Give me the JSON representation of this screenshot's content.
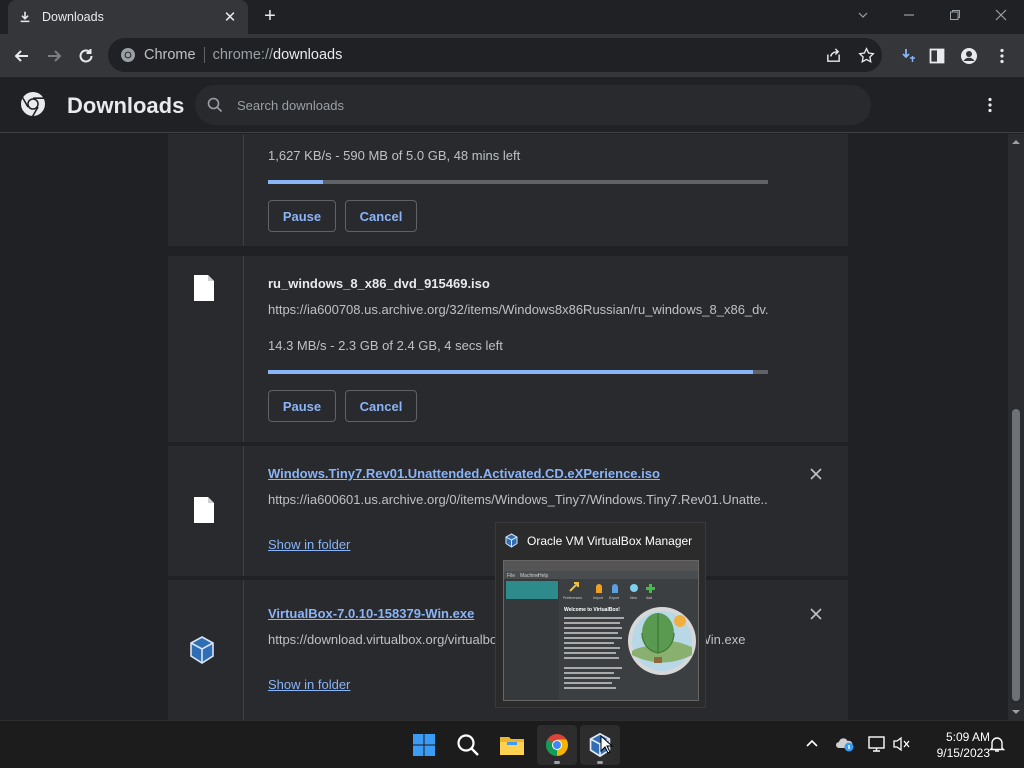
{
  "tab": {
    "title": "Downloads",
    "icon": "download-icon"
  },
  "window_controls": {
    "search_tabs": "chevron-down-icon",
    "minimize": "minimize-icon",
    "restore": "restore-icon",
    "close": "close-icon"
  },
  "toolbar": {
    "site_chip": "Chrome",
    "url_scheme": "chrome://",
    "url_host": "downloads"
  },
  "page": {
    "title": "Downloads",
    "search_placeholder": "Search downloads"
  },
  "downloads": [
    {
      "status": "1,627 KB/s - 590 MB of 5.0 GB, 48 mins left",
      "progress": 0.11,
      "pause_label": "Pause",
      "cancel_label": "Cancel"
    },
    {
      "name": "ru_windows_8_x86_dvd_915469.iso",
      "url": "https://ia600708.us.archive.org/32/items/Windows8x86Russian/ru_windows_8_x86_dv...",
      "status": "14.3 MB/s - 2.3 GB of 2.4 GB, 4 secs left",
      "progress": 0.97,
      "pause_label": "Pause",
      "cancel_label": "Cancel"
    },
    {
      "name": "Windows.Tiny7.Rev01.Unattended.Activated.CD.eXPerience.iso",
      "url": "https://ia600601.us.archive.org/0/items/Windows_Tiny7/Windows.Tiny7.Rev01.Unatte...",
      "show_in_folder": "Show in folder"
    },
    {
      "name": "VirtualBox-7.0.10-158379-Win.exe",
      "url": "https://download.virtualbox.org/virtualbox/7.0.10/VirtualBox-7.0.10-158379-Win.exe",
      "show_in_folder": "Show in folder"
    }
  ],
  "preview": {
    "title": "Oracle VM VirtualBox Manager",
    "thumb_menu": [
      "File",
      "Machine",
      "Help"
    ],
    "thumb_tools": [
      "Preferences",
      "Import",
      "Export",
      "New",
      "Add"
    ],
    "thumb_welcome": "Welcome to VirtualBox!"
  },
  "taskbar": {
    "apps": [
      "start-icon",
      "search-icon",
      "file-explorer-icon",
      "chrome-icon",
      "virtualbox-icon"
    ],
    "time": "5:09 AM",
    "date": "9/15/2023"
  },
  "colors": {
    "accent": "#8ab4f8",
    "bg": "#202124",
    "card": "#292a2d"
  }
}
